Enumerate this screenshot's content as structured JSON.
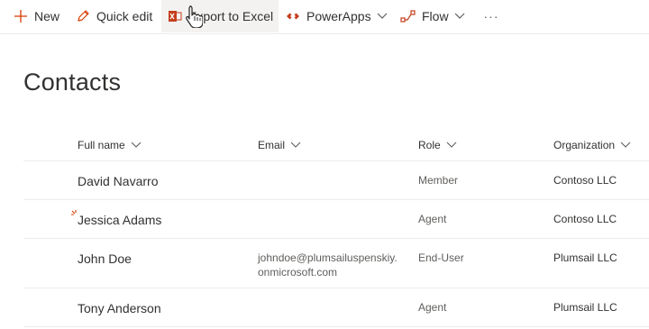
{
  "commandbar": {
    "new_label": "New",
    "quick_edit_label": "Quick edit",
    "export_label": "Export to Excel",
    "powerapps_label": "PowerApps",
    "flow_label": "Flow",
    "more_label": "···"
  },
  "page": {
    "title": "Contacts"
  },
  "list": {
    "columns": [
      {
        "label": "Full name"
      },
      {
        "label": "Email"
      },
      {
        "label": "Role"
      },
      {
        "label": "Organization"
      }
    ],
    "rows": [
      {
        "full_name": "David Navarro",
        "email": "",
        "role": "Member",
        "organization": "Contoso LLC"
      },
      {
        "full_name": "Jessica Adams",
        "email": "",
        "role": "Agent",
        "organization": "Contoso LLC"
      },
      {
        "full_name": "John Doe",
        "email_line1": "johndoe@plumsailuspenskiy.",
        "email_line2": "onmicrosoft.com",
        "role": "End-User",
        "organization": "Plumsail LLC"
      },
      {
        "full_name": "Tony Anderson",
        "email": "",
        "role": "Agent",
        "organization": "Plumsail LLC"
      }
    ]
  },
  "colors": {
    "accent": "#d83b01",
    "excel": "#c43e1c"
  }
}
